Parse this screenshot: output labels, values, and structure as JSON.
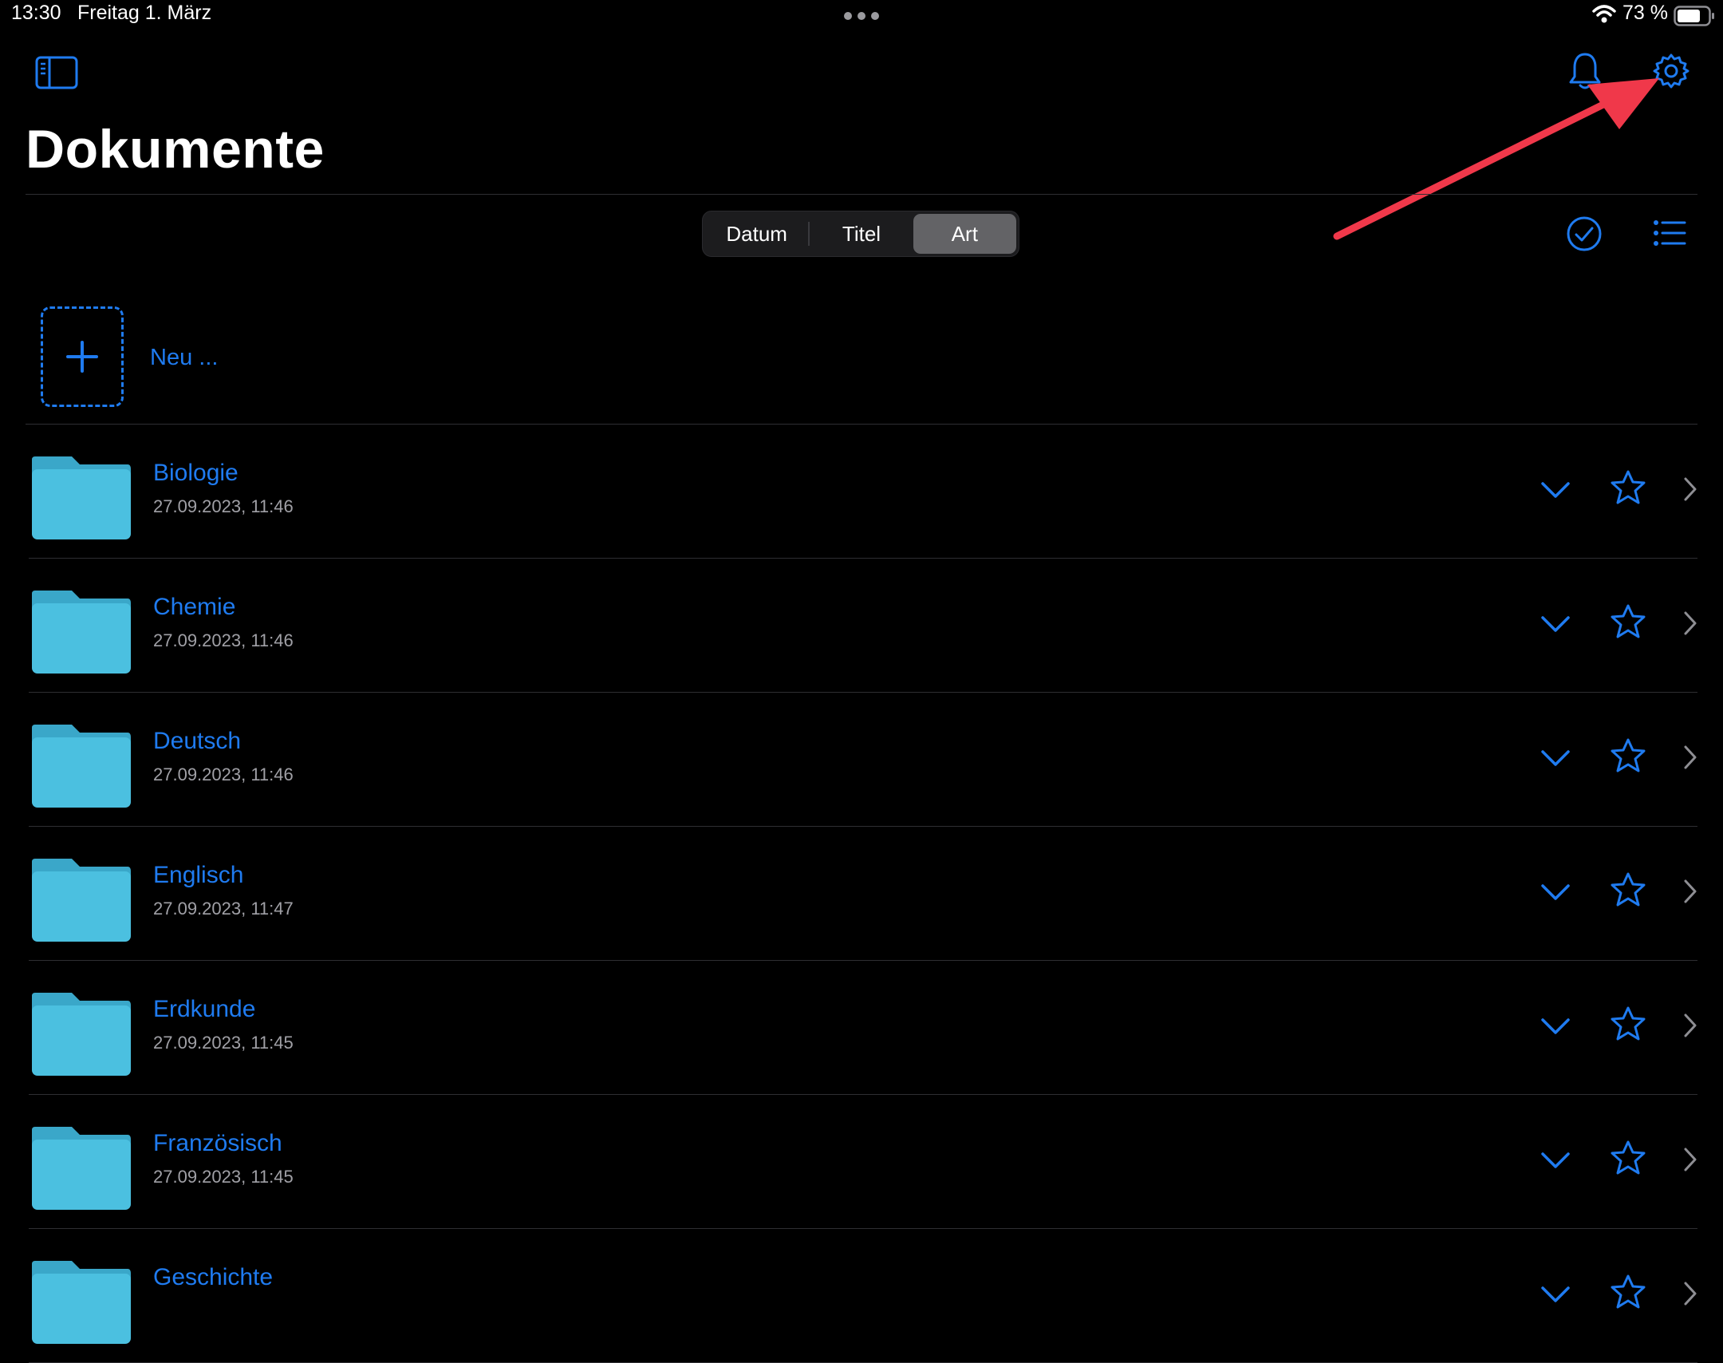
{
  "status_bar": {
    "time": "13:30",
    "date": "Freitag 1. März",
    "battery": "73 %"
  },
  "header": {
    "title": "Dokumente"
  },
  "sort": {
    "options": [
      "Datum",
      "Titel",
      "Art"
    ],
    "selected": "Art"
  },
  "new_item": {
    "label": "Neu ..."
  },
  "folders": [
    {
      "title": "Biologie",
      "date": "27.09.2023, 11:46"
    },
    {
      "title": "Chemie",
      "date": "27.09.2023, 11:46"
    },
    {
      "title": "Deutsch",
      "date": "27.09.2023, 11:46"
    },
    {
      "title": "Englisch",
      "date": "27.09.2023, 11:47"
    },
    {
      "title": "Erdkunde",
      "date": "27.09.2023, 11:45"
    },
    {
      "title": "Französisch",
      "date": "27.09.2023, 11:45"
    },
    {
      "title": "Geschichte",
      "date": ""
    }
  ],
  "colors": {
    "accent": "#1f7bf0",
    "folder": "#4bc0e0",
    "annotation_arrow": "#f0384a"
  },
  "icons": [
    "sidebar-icon",
    "bell-icon",
    "gear-icon",
    "checkmark-circle-icon",
    "list-icon",
    "plus-icon",
    "folder-icon",
    "chevron-down-icon",
    "star-icon",
    "chevron-right-icon"
  ]
}
